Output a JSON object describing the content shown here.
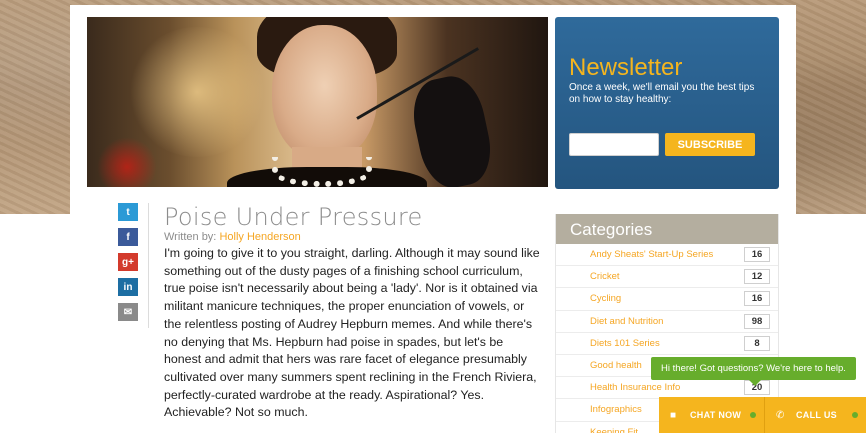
{
  "newsletter": {
    "title": "Newsletter",
    "text": "Once a week, we'll email you the best tips on how to stay healthy:",
    "input_placeholder": "",
    "button": "SUBSCRIBE"
  },
  "share": {
    "twitter": "t",
    "facebook": "f",
    "googleplus": "g+",
    "linkedin": "in",
    "email": "✉"
  },
  "article": {
    "title": "Poise Under Pressure",
    "written_by": "Written by:",
    "author": "Holly Henderson",
    "body": "I'm going to give it to you straight, darling. Although it may sound like something out of the dusty pages of a finishing school curriculum, true poise isn't necessarily about being a 'lady'. Nor is it obtained via militant manicure techniques, the proper enunciation of vowels, or the relentless posting of Audrey Hepburn memes. And while there's no denying that Ms. Hepburn had poise in spades, but let's be honest and admit that hers was rare facet of elegance presumably cultivated over many summers spent reclining in the French Riviera, perfectly-curated wardrobe at the ready.  Aspirational? Yes. Achievable? Not so much."
  },
  "categories": {
    "heading": "Categories",
    "items": [
      {
        "label": "Andy Sheats' Start-Up Series",
        "count": "16"
      },
      {
        "label": "Cricket",
        "count": "12"
      },
      {
        "label": "Cycling",
        "count": "16"
      },
      {
        "label": "Diet and Nutrition",
        "count": "98"
      },
      {
        "label": "Diets 101 Series",
        "count": "8"
      },
      {
        "label": "Good health",
        "count": ""
      },
      {
        "label": "Health Insurance Info",
        "count": "20"
      },
      {
        "label": "Infographics",
        "count": ""
      },
      {
        "label": "Keeping Fit",
        "count": ""
      }
    ]
  },
  "chat": {
    "tip": "Hi there! Got questions? We're here to help.",
    "chat_now": "CHAT NOW",
    "call_us": "CALL US"
  },
  "colors": {
    "accent": "#f5b51e",
    "newsletter_bg": "#2f6a9b",
    "chat_green": "#67ad2c",
    "twitter": "#2b9ad6",
    "facebook": "#3b5a9a",
    "googleplus": "#d33a2c",
    "linkedin": "#1d6ea3",
    "email": "#8a8a8a"
  }
}
